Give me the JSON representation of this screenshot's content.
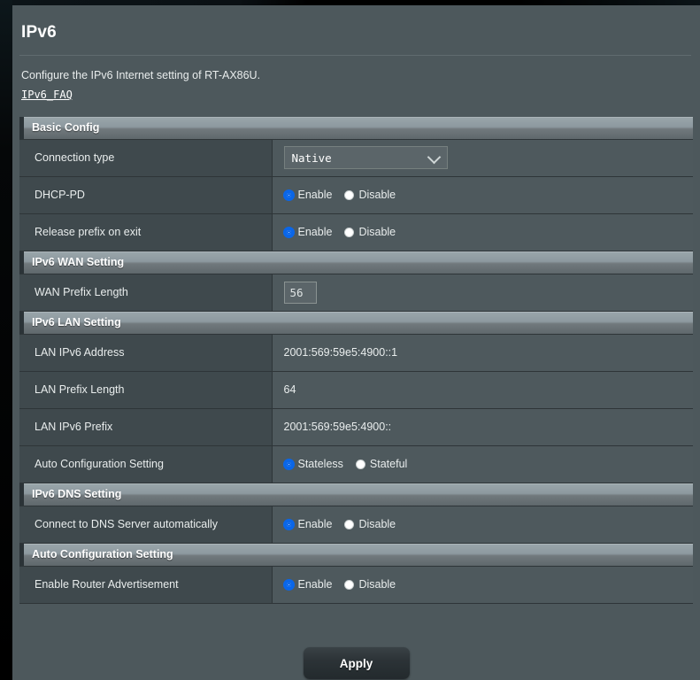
{
  "page": {
    "title": "IPv6",
    "description": "Configure the IPv6 Internet setting of RT-AX86U.",
    "faq_link": "IPv6_FAQ"
  },
  "sections": [
    {
      "heading": "Basic Config",
      "rows": [
        {
          "label": "Connection type",
          "control": "select",
          "value": "Native",
          "options": [
            "Native"
          ]
        },
        {
          "label": "DHCP-PD",
          "control": "radio",
          "options": [
            {
              "label": "Enable",
              "selected": true
            },
            {
              "label": "Disable",
              "selected": false
            }
          ]
        },
        {
          "label": "Release prefix on exit",
          "control": "radio",
          "options": [
            {
              "label": "Enable",
              "selected": true
            },
            {
              "label": "Disable",
              "selected": false
            }
          ]
        }
      ]
    },
    {
      "heading": "IPv6 WAN Setting",
      "rows": [
        {
          "label": "WAN Prefix Length",
          "control": "text",
          "value": "56"
        }
      ]
    },
    {
      "heading": "IPv6 LAN Setting",
      "rows": [
        {
          "label": "LAN IPv6 Address",
          "control": "static",
          "value": "2001:569:59e5:4900::1"
        },
        {
          "label": "LAN Prefix Length",
          "control": "static",
          "value": "64"
        },
        {
          "label": "LAN IPv6 Prefix",
          "control": "static",
          "value": "2001:569:59e5:4900::"
        },
        {
          "label": "Auto Configuration Setting",
          "control": "radio",
          "options": [
            {
              "label": "Stateless",
              "selected": true
            },
            {
              "label": "Stateful",
              "selected": false
            }
          ]
        }
      ]
    },
    {
      "heading": "IPv6 DNS Setting",
      "rows": [
        {
          "label": "Connect to DNS Server automatically",
          "control": "radio",
          "options": [
            {
              "label": "Enable",
              "selected": true
            },
            {
              "label": "Disable",
              "selected": false
            }
          ]
        }
      ]
    },
    {
      "heading": "Auto Configuration Setting",
      "rows": [
        {
          "label": "Enable Router Advertisement",
          "control": "radio",
          "options": [
            {
              "label": "Enable",
              "selected": true
            },
            {
              "label": "Disable",
              "selected": false
            }
          ]
        }
      ]
    }
  ],
  "footer": {
    "apply_label": "Apply"
  },
  "colors": {
    "accent_selected": "#0a66e8",
    "panel_bg": "#4d585c",
    "label_cell_bg": "#3f494d",
    "value_cell_bg": "#4e595d",
    "section_header_light": "#9aa6ab",
    "section_header_dark": "#5f686c"
  }
}
